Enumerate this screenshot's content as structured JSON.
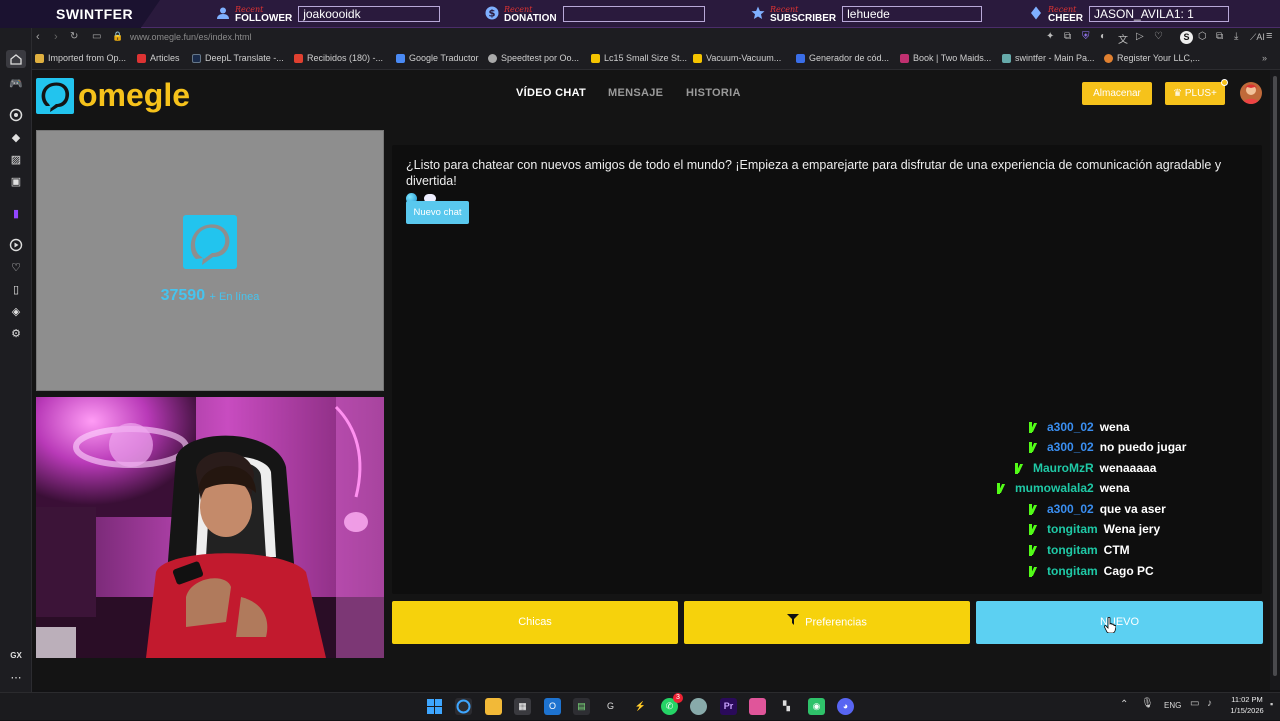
{
  "overlay": {
    "brand": "SWINTFER",
    "recent_label": "Recent",
    "items": [
      {
        "type": "FOLLOWER",
        "value": "joakoooidk"
      },
      {
        "type": "DONATION",
        "value": ""
      },
      {
        "type": "SUBSCRIBER",
        "value": "lehuede"
      },
      {
        "type": "CHEER",
        "value": "JASON_AVILA1: 1"
      }
    ]
  },
  "browser": {
    "url": "www.omegle.fun/es/index.html",
    "ai_label": "AI",
    "gx_label": "GX",
    "bookmarks": [
      {
        "label": "Imported from Op...",
        "color": "#e0b040"
      },
      {
        "label": "Articles",
        "color": "#d33"
      },
      {
        "label": "DeepL Translate -...",
        "color": "#1a2b4a"
      },
      {
        "label": "Recibidos (180) -...",
        "color": "#e04030"
      },
      {
        "label": "Google Traductor",
        "color": "#4a8af4"
      },
      {
        "label": "Speedtest por Oo...",
        "color": "#aaa"
      },
      {
        "label": "Lc15 Small Size St...",
        "color": "#f5c400"
      },
      {
        "label": "Vacuum-Vacuum...",
        "color": "#f5c400"
      },
      {
        "label": "Generador de cód...",
        "color": "#3a6ee8"
      },
      {
        "label": "Book | Two Maids...",
        "color": "#c03070"
      },
      {
        "label": "swintfer - Main Pa...",
        "color": "#6aa"
      },
      {
        "label": "Register Your LLC,...",
        "color": "#e08030"
      }
    ]
  },
  "site": {
    "logo_text": "omegle",
    "nav": [
      {
        "label": "VÍDEO CHAT",
        "active": true
      },
      {
        "label": "MENSAJE",
        "active": false
      },
      {
        "label": "HISTORIA",
        "active": false
      }
    ],
    "store_button": "Almacenar",
    "plus_button": "PLUS+",
    "online_count": "37590",
    "online_label": "+ En línea",
    "welcome_text": "¿Listo para chatear con nuevos amigos de todo el mundo? ¡Empieza a emparejarte para disfrutar de una experiencia de comunicación agradable y divertida!",
    "new_chat_button": "Nuevo chat",
    "girls_button": "Chicas",
    "prefs_button": "Preferencias",
    "next_button": "NUEVO"
  },
  "chat_overlay": [
    {
      "user": "a300_02",
      "text": "wena",
      "color": "#3a8ef0"
    },
    {
      "user": "a300_02",
      "text": "no puedo jugar",
      "color": "#3a8ef0"
    },
    {
      "user": "MauroMzR",
      "text": "wenaaaaa",
      "color": "#1fc9a6"
    },
    {
      "user": "mumowalala2",
      "text": "wena",
      "color": "#1fc9a6"
    },
    {
      "user": "a300_02",
      "text": "que va aser",
      "color": "#3a8ef0"
    },
    {
      "user": "tongitam",
      "text": "Wena jery",
      "color": "#1fc9a6"
    },
    {
      "user": "tongitam",
      "text": "CTM",
      "color": "#1fc9a6"
    },
    {
      "user": "tongitam",
      "text": "Cago PC",
      "color": "#1fc9a6"
    }
  ],
  "taskbar": {
    "language": "ENG",
    "time": "11:02 PM",
    "date": "1/15/2026",
    "whatsapp_badge": "3"
  },
  "colors": {
    "accent_yellow": "#f6c21b",
    "accent_blue": "#59c8ee",
    "kick_green": "#53fc18"
  }
}
